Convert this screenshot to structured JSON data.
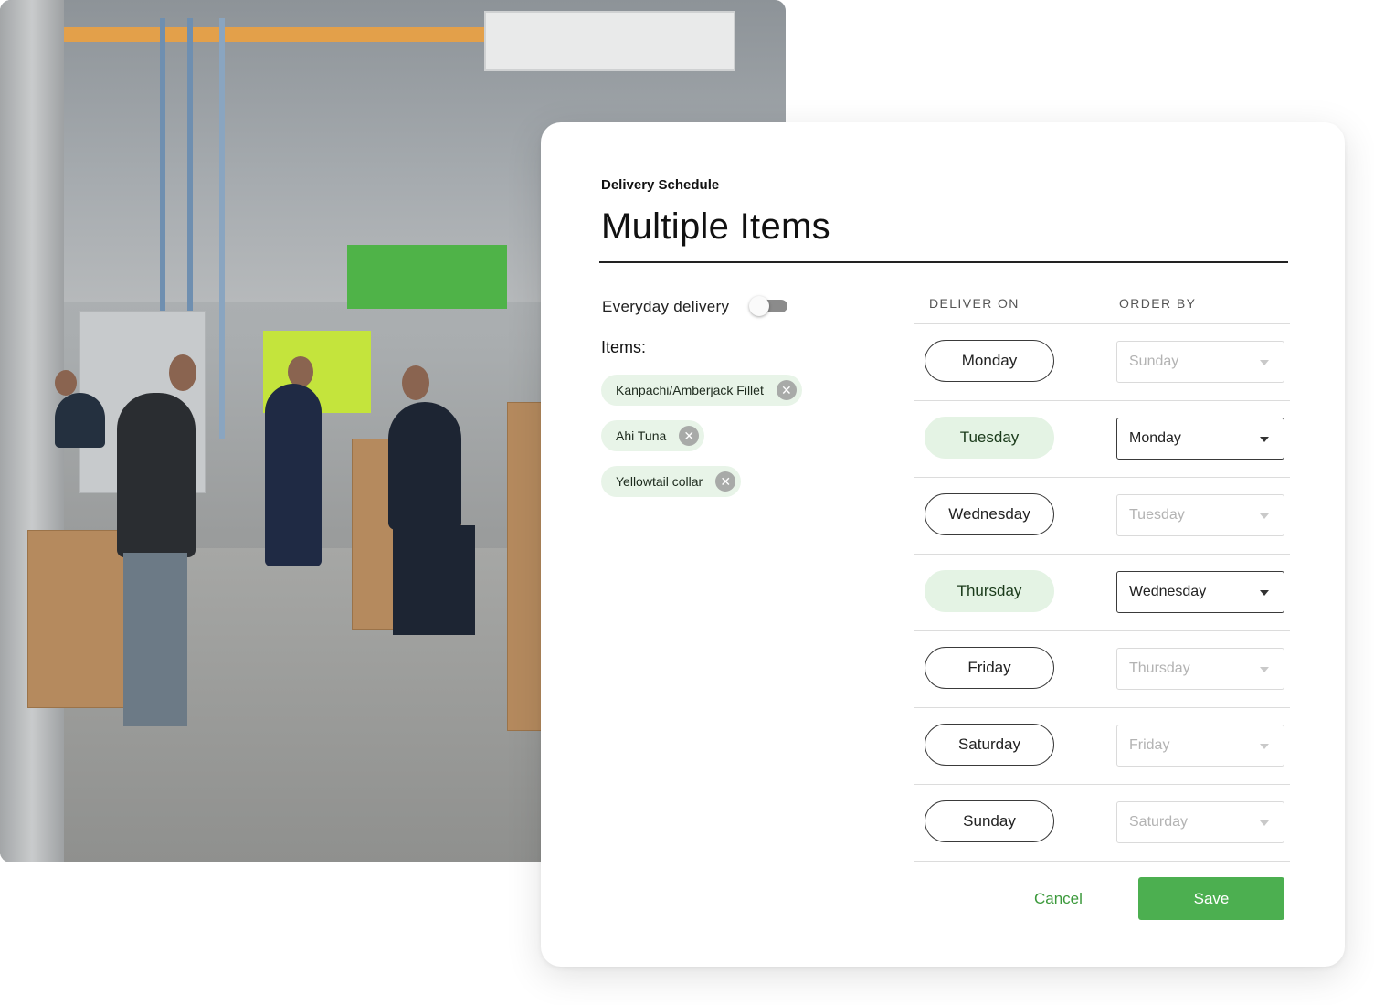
{
  "dialog": {
    "subtitle": "Delivery Schedule",
    "title": "Multiple Items",
    "everyday_label": "Everyday delivery",
    "everyday_enabled": false,
    "items_label": "Items:",
    "items": [
      {
        "name": "Kanpachi/Amberjack Fillet",
        "remove_icon": "close-circle-icon"
      },
      {
        "name": "Ahi Tuna",
        "remove_icon": "close-circle-icon"
      },
      {
        "name": "Yellowtail collar",
        "remove_icon": "close-circle-icon"
      }
    ],
    "columns": {
      "deliver_on": "DELIVER ON",
      "order_by": "ORDER BY"
    },
    "schedule": [
      {
        "day": "Monday",
        "selected": false,
        "order_by": "Sunday"
      },
      {
        "day": "Tuesday",
        "selected": true,
        "order_by": "Monday"
      },
      {
        "day": "Wednesday",
        "selected": false,
        "order_by": "Tuesday"
      },
      {
        "day": "Thursday",
        "selected": true,
        "order_by": "Wednesday"
      },
      {
        "day": "Friday",
        "selected": false,
        "order_by": "Thursday"
      },
      {
        "day": "Saturday",
        "selected": false,
        "order_by": "Friday"
      },
      {
        "day": "Sunday",
        "selected": false,
        "order_by": "Saturday"
      }
    ],
    "cancel_label": "Cancel",
    "save_label": "Save"
  },
  "colors": {
    "accent": "#4caf50",
    "accent_text": "#3c9a3c",
    "selected_fill": "#e4f3e4",
    "chip_fill": "#e8f4e8"
  },
  "background": {
    "image_icon": "warehouse-photo"
  }
}
